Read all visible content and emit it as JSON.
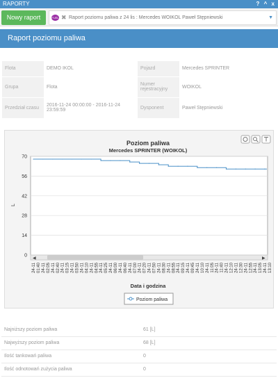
{
  "window": {
    "title": "RAPORTY",
    "controls": "? ^ x"
  },
  "toolbar": {
    "new_report_label": "Nowy raport",
    "tab_badge": "FUEL",
    "tab_title": "Raport poziomu paliwa z 24 lis : Mercedes WOIKOL Paweł Stępniewski"
  },
  "panel": {
    "title": "Raport poziomu paliwa"
  },
  "info": {
    "fleet_label": "Flota",
    "fleet_value": "DEMO IKOL",
    "vehicle_label": "Pojazd",
    "vehicle_value": "Mercedes SPRINTER",
    "group_label": "Grupa",
    "group_value": "Flota",
    "reg_label": "Numer rejestracyjny",
    "reg_value": "WOIKOL",
    "period_label": "Przedział czasu",
    "period_value": "2016-11-24 00:00:00 - 2016-11-24 23:59:59",
    "dispatcher_label": "Dysponent",
    "dispatcher_value": "Paweł Stępniewski"
  },
  "chart_icons": [
    "zoom-reset-icon",
    "zoom-icon",
    "export-icon"
  ],
  "chart_data": {
    "type": "line",
    "title": "Poziom paliwa",
    "subtitle": "Mercedes SPRINTER (WOIKOL)",
    "xlabel": "Data i godzina",
    "ylabel": "L",
    "ylim": [
      0,
      70
    ],
    "yticks": [
      0,
      14,
      28,
      42,
      56,
      70
    ],
    "grid": true,
    "legend_position": "bottom",
    "x_tick_labels": [
      "24-11 01:40",
      "24-11 02:05",
      "24-11 02:40",
      "24-11 03:15",
      "24-11 03:50",
      "24-11 04:10",
      "24-11 04:55",
      "24-11 05:25",
      "24-11 06:00",
      "24-11 06:40",
      "24-11 07:00",
      "24-11 07:20",
      "24-11 07:50",
      "24-11 08:30",
      "24-11 08:55",
      "24-11 09:15",
      "24-11 09:45",
      "24-11 10:10",
      "24-11 11:05",
      "24-11 11:40",
      "24-11 12:10",
      "24-11 12:30",
      "24-11 12:55",
      "24-11 13:05",
      "24-11 13:10"
    ],
    "series": [
      {
        "name": "Poziom paliwa",
        "color": "#4a90c8",
        "values": [
          68,
          68,
          68,
          68,
          68,
          68,
          68,
          67,
          67,
          67,
          66,
          65,
          65,
          64,
          63,
          63,
          63,
          62,
          62,
          62,
          61,
          61,
          61,
          61,
          61
        ]
      }
    ]
  },
  "stats": [
    {
      "label": "Najniższy poziom paliwa",
      "value": "61 [L]"
    },
    {
      "label": "Najwyższy poziom paliwa",
      "value": "68 [L]"
    },
    {
      "label": "Ilość tankowań paliwa",
      "value": "0"
    },
    {
      "label": "Ilość odnotowań zużycia paliwa",
      "value": "0"
    }
  ]
}
